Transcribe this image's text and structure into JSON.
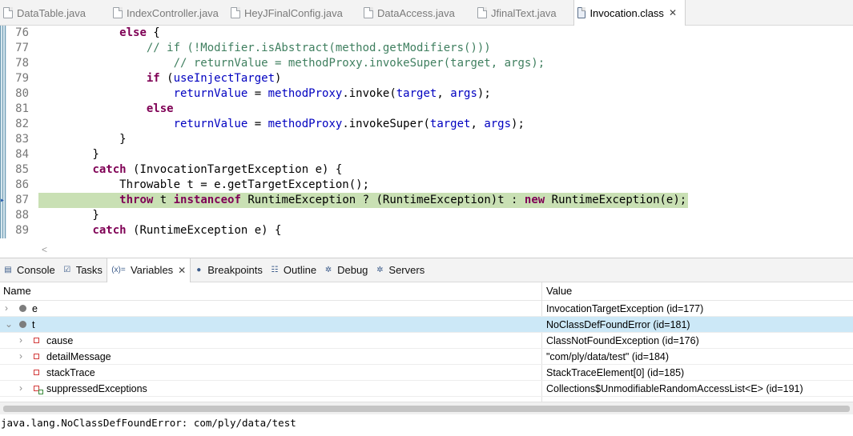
{
  "editor_tabs": [
    {
      "label": "DataTable.java",
      "active": false
    },
    {
      "label": "IndexController.java",
      "active": false
    },
    {
      "label": "HeyJFinalConfig.java",
      "active": false
    },
    {
      "label": "DataAccess.java",
      "active": false
    },
    {
      "label": "JfinalText.java",
      "active": false
    },
    {
      "label": "Invocation.class",
      "active": true,
      "close": "✕"
    }
  ],
  "code": {
    "lines": [
      {
        "num": "76",
        "html": "            <span class=\"kw\">else</span> {"
      },
      {
        "num": "77",
        "html": "                <span class=\"cm\">// if (!Modifier.isAbstract(method.getModifiers()))</span>"
      },
      {
        "num": "78",
        "html": "                    <span class=\"cm\">// returnValue = methodProxy.invokeSuper(target, args);</span>"
      },
      {
        "num": "79",
        "html": "                <span class=\"kw\">if</span> (<span class=\"fd\">useInjectTarget</span>)"
      },
      {
        "num": "80",
        "html": "                    <span class=\"fd\">returnValue</span> = <span class=\"fd\">methodProxy</span>.invoke(<span class=\"fd\">target</span>, <span class=\"fd\">args</span>);"
      },
      {
        "num": "81",
        "html": "                <span class=\"kw\">else</span>"
      },
      {
        "num": "82",
        "html": "                    <span class=\"fd\">returnValue</span> = <span class=\"fd\">methodProxy</span>.invokeSuper(<span class=\"fd\">target</span>, <span class=\"fd\">args</span>);"
      },
      {
        "num": "83",
        "html": "            }"
      },
      {
        "num": "84",
        "html": "        }"
      },
      {
        "num": "85",
        "html": "        <span class=\"kw\">catch</span> (InvocationTargetException e) {"
      },
      {
        "num": "86",
        "html": "            Throwable t = e.getTargetException();"
      },
      {
        "num": "87",
        "html": "            <span class=\"kw\">throw</span> t <span class=\"kw\">instanceof</span> RuntimeException ? (RuntimeException)t : <span class=\"kw\">new</span> RuntimeException(e);",
        "current": true
      },
      {
        "num": "88",
        "html": "        }"
      },
      {
        "num": "89",
        "html": "        <span class=\"kw\">catch</span> (RuntimeException e) {"
      }
    ],
    "scroll_left": "<"
  },
  "view_tabs": [
    {
      "label": "Console",
      "icon": "console-icon",
      "glyph": "▤"
    },
    {
      "label": "Tasks",
      "icon": "tasks-icon",
      "glyph": "☑"
    },
    {
      "label": "Variables",
      "icon": "variables-icon",
      "glyph": "(x)=",
      "active": true,
      "close": "✕"
    },
    {
      "label": "Breakpoints",
      "icon": "breakpoints-icon",
      "glyph": "●"
    },
    {
      "label": "Outline",
      "icon": "outline-icon",
      "glyph": "☷"
    },
    {
      "label": "Debug",
      "icon": "debug-icon",
      "glyph": "✲"
    },
    {
      "label": "Servers",
      "icon": "servers-icon",
      "glyph": "✲"
    }
  ],
  "variables": {
    "header_name": "Name",
    "header_value": "Value",
    "rows": [
      {
        "name": "e",
        "value": "InvocationTargetException  (id=177)",
        "toggle": "›",
        "icon": "pkg",
        "indent": 0,
        "selected": false
      },
      {
        "name": "t",
        "value": "NoClassDefFoundError  (id=181)",
        "toggle": "⌄",
        "icon": "pkg",
        "indent": 0,
        "selected": true
      },
      {
        "name": "cause",
        "value": "ClassNotFoundException  (id=176)",
        "toggle": "›",
        "icon": "priv",
        "indent": 1,
        "selected": false
      },
      {
        "name": "detailMessage",
        "value": "\"com/ply/data/test\" (id=184)",
        "toggle": "›",
        "icon": "priv",
        "indent": 1,
        "selected": false
      },
      {
        "name": "stackTrace",
        "value": "StackTraceElement[0]  (id=185)",
        "toggle": "",
        "icon": "priv",
        "indent": 1,
        "selected": false
      },
      {
        "name": "suppressedExceptions",
        "value": "Collections$UnmodifiableRandomAccessList<E>  (id=191)",
        "toggle": "›",
        "icon": "privfinal",
        "indent": 1,
        "selected": false
      }
    ]
  },
  "detail_text": "java.lang.NoClassDefFoundError: com/ply/data/test"
}
